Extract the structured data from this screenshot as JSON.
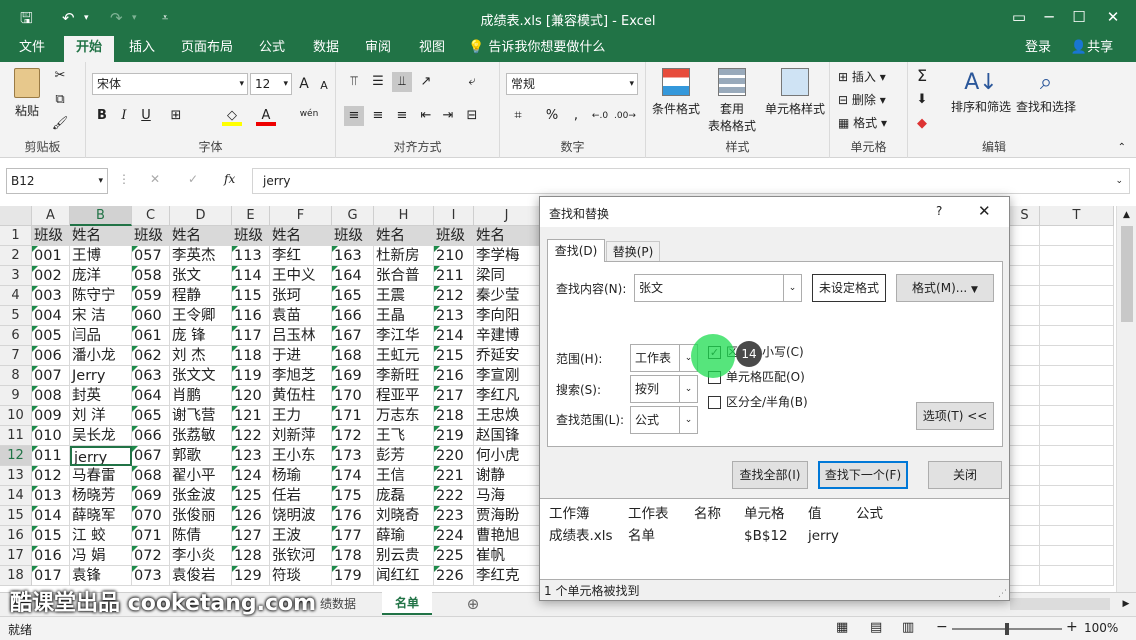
{
  "window": {
    "title": "成绩表.xls  [兼容模式] - Excel"
  },
  "menu": {
    "tabs": [
      "文件",
      "开始",
      "插入",
      "页面布局",
      "公式",
      "数据",
      "审阅",
      "视图"
    ],
    "tell_me": "告诉我你想要做什么",
    "login": "登录",
    "share": "共享"
  },
  "ribbon": {
    "clipboard": {
      "label": "剪贴板",
      "paste": "粘贴"
    },
    "font": {
      "label": "字体",
      "name": "宋体",
      "size": "12",
      "bold": "B",
      "italic": "I",
      "underline": "U",
      "grow": "A",
      "shrink": "A",
      "wen": "wén"
    },
    "align": {
      "label": "对齐方式"
    },
    "number": {
      "label": "数字",
      "format": "常规",
      "percent": "%",
      "comma": ","
    },
    "styles": {
      "label": "样式",
      "cond": "条件格式",
      "table1": "套用",
      "table2": "表格格式",
      "cell": "单元格样式"
    },
    "cells": {
      "label": "单元格",
      "insert": "插入",
      "delete": "删除",
      "format": "格式"
    },
    "edit": {
      "label": "编辑",
      "sort": "排序和筛选",
      "find": "查找和选择",
      "sigma": "Σ"
    }
  },
  "formula_bar": {
    "name_box": "B12",
    "fx": "fx",
    "value": "jerry"
  },
  "grid": {
    "columns": [
      "A",
      "B",
      "C",
      "D",
      "E",
      "F",
      "G",
      "H",
      "I",
      "J",
      "S",
      "T"
    ],
    "rows": [
      [
        "班级",
        "姓名",
        "班级",
        "姓名",
        "班级",
        "姓名",
        "班级",
        "姓名",
        "班级",
        "姓名"
      ],
      [
        "001",
        "王博",
        "057",
        "李英杰",
        "113",
        "李红",
        "163",
        "杜新房",
        "210",
        "李学梅"
      ],
      [
        "002",
        "庞洋",
        "058",
        "张文",
        "114",
        "王中义",
        "164",
        "张合普",
        "211",
        "梁同"
      ],
      [
        "003",
        "陈守宁",
        "059",
        "程静",
        "115",
        "张珂",
        "165",
        "王震",
        "212",
        "秦少莹"
      ],
      [
        "004",
        "宋  洁",
        "060",
        "王令卿",
        "116",
        "袁苗",
        "166",
        "王晶",
        "213",
        "李向阳"
      ],
      [
        "005",
        "闫品",
        "061",
        "庞  锋",
        "117",
        "吕玉林",
        "167",
        "李江华",
        "214",
        "辛建博"
      ],
      [
        "006",
        "潘小龙",
        "062",
        "刘  杰",
        "118",
        "于进",
        "168",
        "王虹元",
        "215",
        "乔延安"
      ],
      [
        "007",
        "Jerry",
        "063",
        "张文文",
        "119",
        "李旭芝",
        "169",
        "李新旺",
        "216",
        "李宣刚"
      ],
      [
        "008",
        "封英",
        "064",
        "肖鹏",
        "120",
        "黄伍柱",
        "170",
        "程亚平",
        "217",
        "李红凡"
      ],
      [
        "009",
        "刘  洋",
        "065",
        "谢飞营",
        "121",
        "王力",
        "171",
        "万志东",
        "218",
        "王忠焕"
      ],
      [
        "010",
        "吴长龙",
        "066",
        "张荔敏",
        "122",
        "刘新萍",
        "172",
        "王飞",
        "219",
        "赵国锋"
      ],
      [
        "011",
        "jerry",
        "067",
        "郭歌",
        "123",
        "王小东",
        "173",
        "彭芳",
        "220",
        "何小虎"
      ],
      [
        "012",
        "马春雷",
        "068",
        "翟小平",
        "124",
        "杨瑜",
        "174",
        "王信",
        "221",
        "谢静"
      ],
      [
        "013",
        "杨晓芳",
        "069",
        "张金波",
        "125",
        "任岩",
        "175",
        "庞磊",
        "222",
        "马海"
      ],
      [
        "014",
        "薛晓军",
        "070",
        "张俊丽",
        "126",
        "饶明波",
        "176",
        "刘晓奇",
        "223",
        "贾海盼"
      ],
      [
        "015",
        "江  蛟",
        "071",
        "陈倩",
        "127",
        "王波",
        "177",
        "薛瑜",
        "224",
        "曹艳旭"
      ],
      [
        "016",
        "冯  娟",
        "072",
        "李小炎",
        "128",
        "张钦河",
        "178",
        "别云贵",
        "225",
        "崔帆"
      ],
      [
        "017",
        "袁锋",
        "073",
        "袁俊岩",
        "129",
        "符琰",
        "179",
        "闻红红",
        "226",
        "李红克"
      ]
    ]
  },
  "sheets": {
    "partial": "绩数据",
    "active": "名单",
    "add": "⊕"
  },
  "status": {
    "ready": "就绪",
    "zoom": "100%"
  },
  "watermark": "酷课堂出品 cooketang.com",
  "dialog": {
    "title": "查找和替换",
    "help": "?",
    "close": "✕",
    "tab_find": "查找(D)",
    "tab_replace": "替换(P)",
    "find_label": "查找内容(N):",
    "find_value": "张文",
    "no_format": "未设定格式",
    "format_btn": "格式(M)...",
    "scope_label": "范围(H):",
    "scope_value": "工作表",
    "search_label": "搜索(S):",
    "search_value": "按列",
    "lookin_label": "查找范围(L):",
    "lookin_value": "公式",
    "opt_case": "区分大小写(C)",
    "opt_whole": "单元格匹配(O)",
    "opt_width": "区分全/半角(B)",
    "options_btn": "选项(T) <<",
    "find_all": "查找全部(I)",
    "find_next": "查找下一个(F)",
    "close_btn": "关闭",
    "result_headers": [
      "工作簿",
      "工作表",
      "名称",
      "单元格",
      "值",
      "公式"
    ],
    "result_row": [
      "成绩表.xls",
      "名单",
      "",
      "$B$12",
      "jerry",
      ""
    ],
    "status": "1 个单元格被找到",
    "step_badge": "14"
  }
}
